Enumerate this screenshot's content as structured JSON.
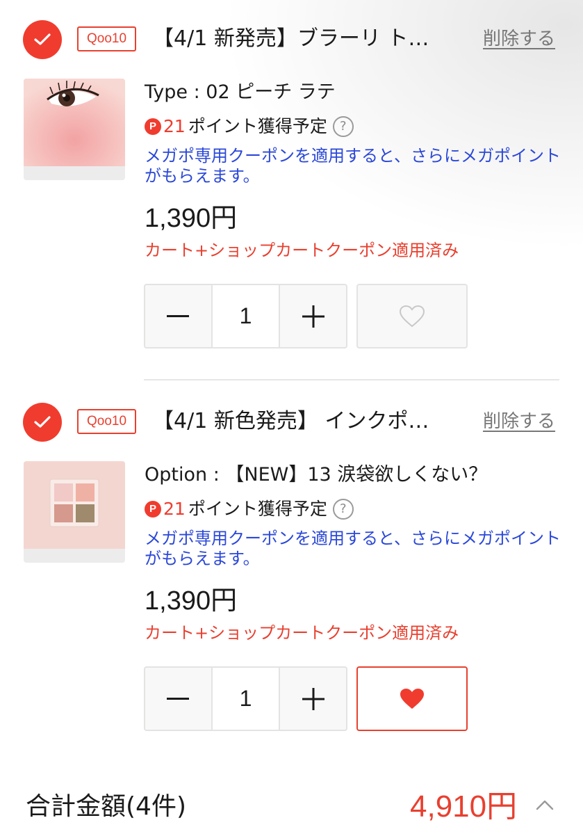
{
  "colors": {
    "accent": "#f03c2e",
    "link_blue": "#2b48d8",
    "coupon_red": "#e8402f"
  },
  "items": [
    {
      "checked": true,
      "shop_badge": "Qoo10",
      "title": "【4/1 新発売】ブラーリ ト…",
      "delete_label": "削除する",
      "thumb": "eye-closeup-product-image",
      "option": "Type : 02 ピーチ ラテ",
      "points_icon": "P",
      "points_value": "21",
      "points_label": "ポイント獲得予定",
      "help_icon": "?",
      "mega_text": "メガポ専用クーポンを適用すると、さらにメガポイントがもらえます。",
      "price": "1,390円",
      "coupon": "カート+ショップカートクーポン適用済み",
      "quantity": "1",
      "favorite": false
    },
    {
      "checked": true,
      "shop_badge": "Qoo10",
      "title": "【4/1 新色発売】 インクポ…",
      "delete_label": "削除する",
      "thumb": "eyeshadow-palette-image",
      "option": "Option : 【NEW】13 涙袋欲しくない？",
      "points_icon": "P",
      "points_value": "21",
      "points_label": "ポイント獲得予定",
      "help_icon": "?",
      "mega_text": "メガポ専用クーポンを適用すると、さらにメガポイントがもらえます。",
      "price": "1,390円",
      "coupon": "カート+ショップカートクーポン適用済み",
      "quantity": "1",
      "favorite": true
    }
  ],
  "total": {
    "label": "合計金額(4件)",
    "amount": "4,910円",
    "toggle_icon": "chevron-up-icon"
  }
}
